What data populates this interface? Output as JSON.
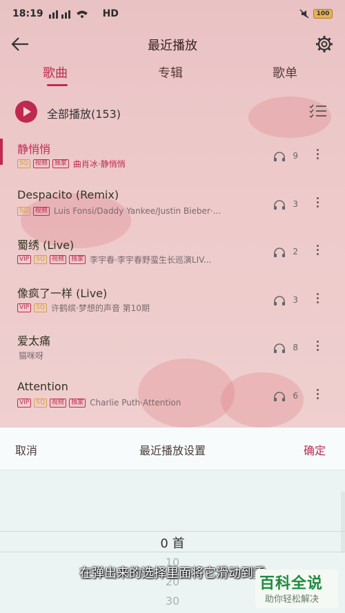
{
  "status_bar": {
    "time": "18:19",
    "network": "HD",
    "battery": "100"
  },
  "header": {
    "title": "最近播放"
  },
  "tabs": [
    {
      "label": "歌曲",
      "active": true
    },
    {
      "label": "专辑",
      "active": false
    },
    {
      "label": "歌单",
      "active": false
    }
  ],
  "play_all": {
    "label": "全部播放(153)"
  },
  "songs": [
    {
      "name": "静悄悄",
      "tags": [
        "SQ",
        "视频",
        "独家"
      ],
      "artist": "曲肖冰·静悄悄",
      "plays": "9",
      "active": true
    },
    {
      "name": "Despacito (Remix)",
      "tags": [
        "SQ",
        "视频"
      ],
      "artist": "Luis Fonsi/Daddy Yankee/Justin Bieber·...",
      "plays": "3"
    },
    {
      "name": "蜀绣 (Live)",
      "tags": [
        "VIP",
        "SQ",
        "视频",
        "独家"
      ],
      "artist": "李宇春·李宇春野蛮生长巡演LIV...",
      "plays": "2"
    },
    {
      "name": "像疯了一样 (Live)",
      "tags": [
        "VIP",
        "SQ"
      ],
      "artist": "许鹤缤·梦想的声音 第10期",
      "plays": "3"
    },
    {
      "name": "爱太痛",
      "tags": [],
      "artist": "猫咪呀",
      "plays": "8"
    },
    {
      "name": "Attention",
      "tags": [
        "VIP",
        "SQ",
        "视频",
        "独家"
      ],
      "artist": "Charlie Puth·Attention",
      "plays": "6"
    }
  ],
  "sheet": {
    "cancel": "取消",
    "title": "最近播放设置",
    "confirm": "确定",
    "selected": "0  首",
    "options": [
      "10",
      "20",
      "30"
    ]
  },
  "caption": "在弹出来的选择里面将它滑动到重",
  "watermark": {
    "title": "百科全说",
    "subtitle": "助你轻松解决"
  },
  "colors": {
    "accent": "#c0294f",
    "sq": "#d6a03a",
    "sheet_bg": "#eef5f5"
  }
}
